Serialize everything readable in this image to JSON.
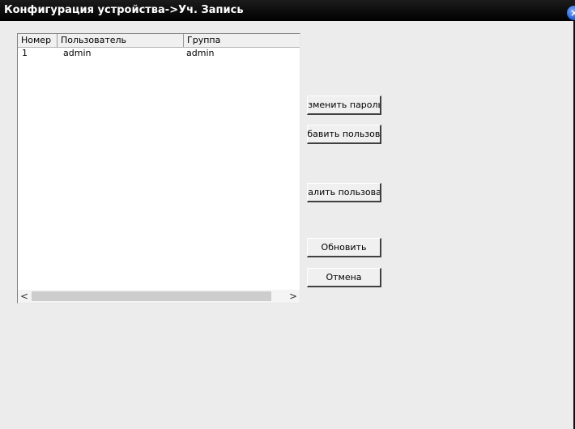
{
  "window": {
    "title": "Конфигурация устройства->Уч. Запись",
    "close_glyph": "×"
  },
  "table": {
    "columns": [
      "Номер",
      "Пользователь",
      "Группа"
    ],
    "rows": [
      {
        "number": "1",
        "user": "admin",
        "group": "admin"
      }
    ]
  },
  "scrollbar": {
    "left_glyph": "<",
    "right_glyph": ">"
  },
  "buttons": {
    "change_password": "Изменить пароль",
    "add_user": "Добавить пользователя",
    "delete_user": "Удалить пользователя",
    "refresh": "Обновить",
    "cancel": "Отмена"
  },
  "icons": {
    "close": "close-icon",
    "scroll_left": "chevron-left-icon",
    "scroll_right": "chevron-right-icon"
  }
}
